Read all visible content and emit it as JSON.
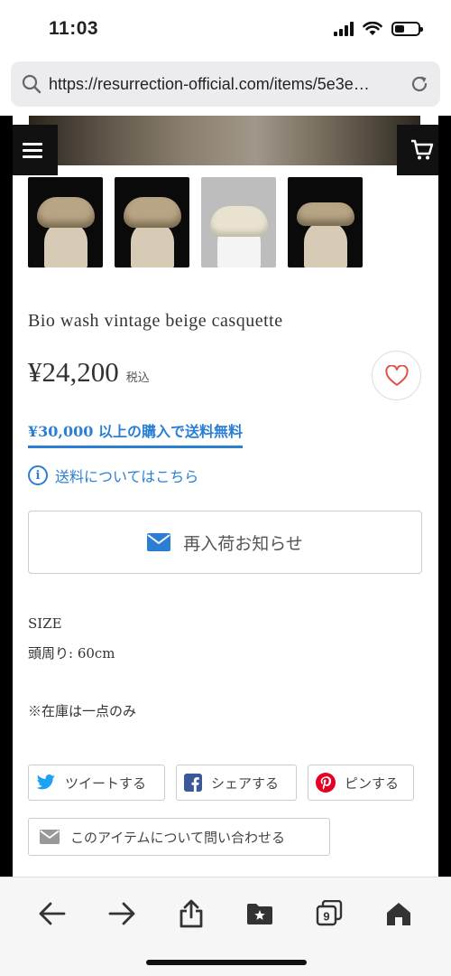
{
  "status_bar": {
    "time": "11:03"
  },
  "browser": {
    "url": "https://resurrection-official.com/items/5e3e…",
    "tab_count": "9"
  },
  "product": {
    "title": "Bio wash vintage beige casquette",
    "price": "¥24,200",
    "tax_label": "税込",
    "free_shipping": "¥30,000 以上の購入で送料無料",
    "shipping_info": "送料についてはこちら",
    "restock_label": "再入荷お知らせ",
    "size_heading": "SIZE",
    "size_value": "頭周り: 60cm",
    "stock_note": "※在庫は一点のみ"
  },
  "share": {
    "tweet": "ツイートする",
    "facebook": "シェアする",
    "pinterest": "ピンする",
    "contact": "このアイテムについて問い合わせる"
  },
  "colors": {
    "accent_blue": "#2a7fd4",
    "heart_red": "#e0534a",
    "twitter_blue": "#1da1f2",
    "facebook_blue": "#3b5998",
    "pinterest_red": "#e60023"
  }
}
